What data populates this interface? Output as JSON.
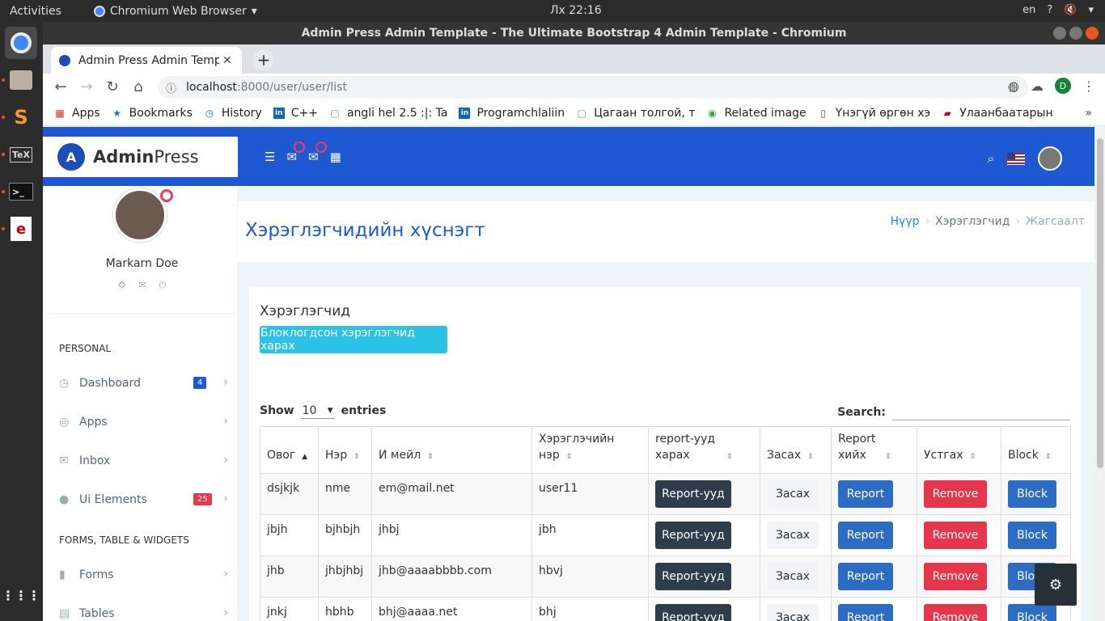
{
  "os": {
    "activities": "Activities",
    "app_name": "Chromium Web Browser",
    "clock": "Лх 22:16",
    "lang": "en"
  },
  "window": {
    "title": "Admin Press Admin Template - The Ultimate Bootstrap 4 Admin Template - Chromium"
  },
  "browser": {
    "tab_title": "Admin Press Admin Template",
    "url_host": "localhost",
    "url_path": ":8000/user/user/list",
    "profile_initial": "D",
    "bookmarks": [
      {
        "label": "Apps",
        "icon": "apps-grid-icon"
      },
      {
        "label": "Bookmarks",
        "icon": "star-icon"
      },
      {
        "label": "History",
        "icon": "history-icon"
      },
      {
        "label": "C++",
        "icon": "linkedin-icon"
      },
      {
        "label": "angli hel 2.5 :|: Ta",
        "icon": "page-icon"
      },
      {
        "label": "Programchlaliin",
        "icon": "linkedin-icon"
      },
      {
        "label": "Цагаан толгой, т",
        "icon": "page-icon"
      },
      {
        "label": "Related image",
        "icon": "owl-icon"
      },
      {
        "label": "Үнэгүй өргөн хэ",
        "icon": "document-icon"
      },
      {
        "label": "Улаанбаатарын",
        "icon": "flag-icon"
      }
    ]
  },
  "app": {
    "brand_a": "Admin",
    "brand_b": "Press",
    "logo_letter": "A",
    "user_name": "Markarn Doe",
    "sections": [
      "PERSONAL",
      "FORMS, TABLE & WIDGETS"
    ],
    "menu": [
      {
        "label": "Dashboard",
        "badge": "4",
        "badge_color": "#1e58d2"
      },
      {
        "label": "Apps"
      },
      {
        "label": "Inbox"
      },
      {
        "label": "Ui Elements",
        "badge": "25",
        "badge_color": "#e6364b"
      },
      {
        "label": "Forms"
      },
      {
        "label": "Tables"
      }
    ],
    "page_title": "Хэрэглэгчидийн хүснэгт",
    "breadcrumb": [
      "Нүүр",
      "Хэрэглэгчид",
      "Жагсаалт"
    ],
    "card_title": "Хэрэглэгчид",
    "blocked_button": "Блоклогдсон хэрэглэгчид харах",
    "show_label": "Show",
    "entries_value": "10",
    "entries_label": "entries",
    "search_label": "Search:",
    "columns": [
      "Овог",
      "Нэр",
      "И мейл",
      "Хэрэглэчийн нэр",
      "report-ууд харах",
      "Засах",
      "Report хийх",
      "Устгах",
      "Block"
    ],
    "buttons": {
      "reports": "Report-ууд",
      "edit": "Засах",
      "report": "Report",
      "remove": "Remove",
      "block": "Block"
    },
    "rows": [
      {
        "last": "dsjkjk",
        "first": "nme",
        "email": "em@mail.net",
        "username": "user11"
      },
      {
        "last": "jbjh",
        "first": "bjhbjh",
        "email": "jhbj",
        "username": "jbh"
      },
      {
        "last": "jhb",
        "first": "jhbjhbj",
        "email": "jhb@aaaabbbb.com",
        "username": "hbvj"
      },
      {
        "last": "jnkj",
        "first": "hbhb",
        "email": "bhj@aaaa.net",
        "username": "bhj"
      }
    ]
  }
}
